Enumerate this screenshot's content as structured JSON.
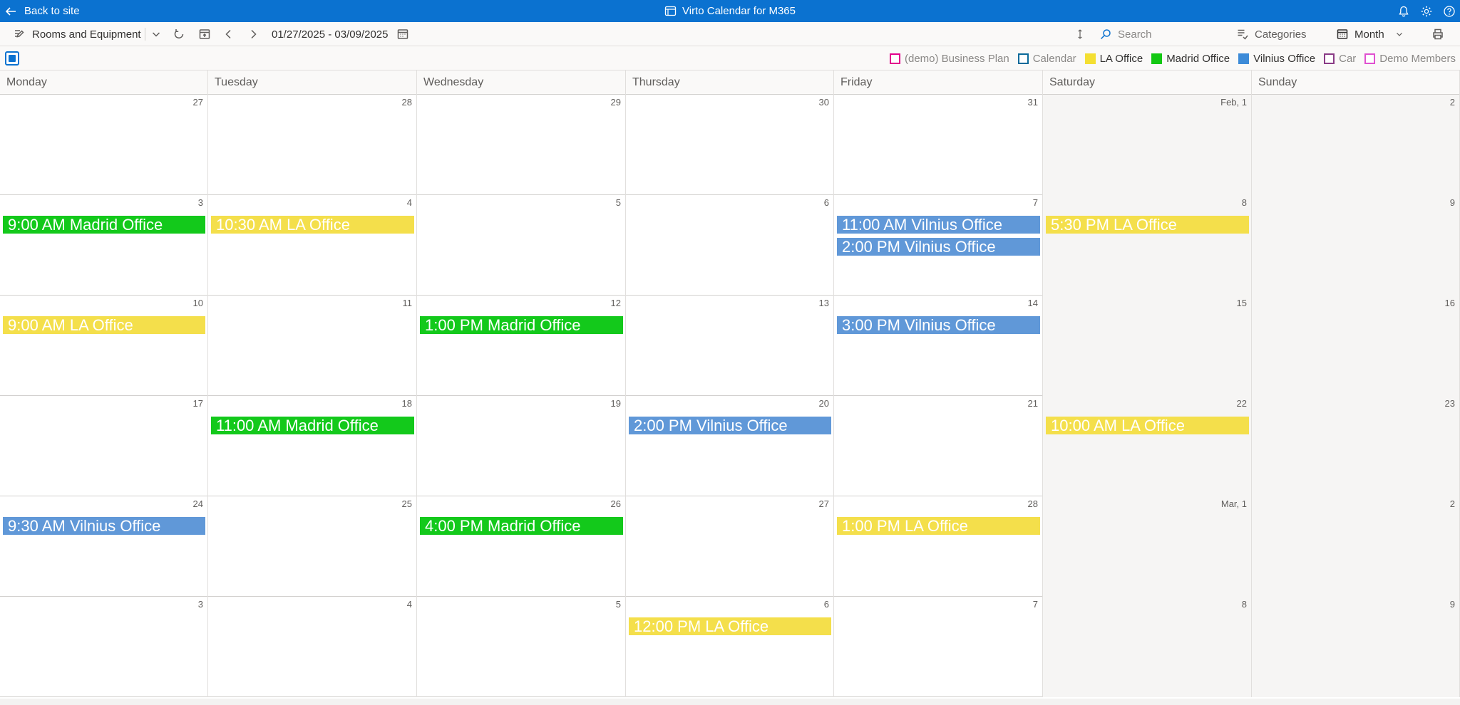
{
  "header": {
    "back_label": "Back to site",
    "app_title": "Virto Calendar for M365"
  },
  "toolbar": {
    "view_name": "Rooms and Equipment",
    "date_range": "01/27/2025 - 03/09/2025",
    "search_placeholder": "Search",
    "categories_label": "Categories",
    "view_mode_label": "Month"
  },
  "legend": [
    {
      "label": "(demo) Business Plan",
      "color": "#e3008c",
      "filled": false
    },
    {
      "label": "Calendar",
      "color": "#0b6a9a",
      "filled": false
    },
    {
      "label": "LA Office",
      "color": "#f4df32",
      "filled": true
    },
    {
      "label": "Madrid Office",
      "color": "#13c813",
      "filled": true
    },
    {
      "label": "Vilnius Office",
      "color": "#3d8bd8",
      "filled": true
    },
    {
      "label": "Car",
      "color": "#8a3b86",
      "filled": false
    },
    {
      "label": "Demo Members",
      "color": "#e050d0",
      "filled": false
    }
  ],
  "colors": {
    "la": "#f4df4b",
    "madrid": "#13c91b",
    "vilnius": "#6098d8",
    "brand": "#0b72d0"
  },
  "weekdays": [
    "Monday",
    "Tuesday",
    "Wednesday",
    "Thursday",
    "Friday",
    "Saturday",
    "Sunday"
  ],
  "weeks": [
    [
      "27",
      "28",
      "29",
      "30",
      "31",
      "Feb, 1",
      "2"
    ],
    [
      "3",
      "4",
      "5",
      "6",
      "7",
      "8",
      "9"
    ],
    [
      "10",
      "11",
      "12",
      "13",
      "14",
      "15",
      "16"
    ],
    [
      "17",
      "18",
      "19",
      "20",
      "21",
      "22",
      "23"
    ],
    [
      "24",
      "25",
      "26",
      "27",
      "28",
      "Mar, 1",
      "2"
    ],
    [
      "3",
      "4",
      "5",
      "6",
      "7",
      "8",
      "9"
    ]
  ],
  "events": [
    {
      "week": 1,
      "day": 0,
      "slot": 0,
      "text": "9:00 AM Madrid Office",
      "cal": "madrid"
    },
    {
      "week": 1,
      "day": 1,
      "slot": 0,
      "text": "10:30 AM LA Office",
      "cal": "la"
    },
    {
      "week": 1,
      "day": 4,
      "slot": 0,
      "text": "11:00 AM Vilnius Office",
      "cal": "vilnius"
    },
    {
      "week": 1,
      "day": 4,
      "slot": 1,
      "text": "2:00 PM Vilnius Office",
      "cal": "vilnius"
    },
    {
      "week": 1,
      "day": 5,
      "slot": 0,
      "text": "5:30 PM LA Office",
      "cal": "la"
    },
    {
      "week": 2,
      "day": 0,
      "slot": 0,
      "text": "9:00 AM LA Office",
      "cal": "la"
    },
    {
      "week": 2,
      "day": 2,
      "slot": 0,
      "text": "1:00 PM Madrid Office",
      "cal": "madrid"
    },
    {
      "week": 2,
      "day": 4,
      "slot": 0,
      "text": "3:00 PM Vilnius Office",
      "cal": "vilnius"
    },
    {
      "week": 3,
      "day": 1,
      "slot": 0,
      "text": "11:00 AM Madrid Office",
      "cal": "madrid"
    },
    {
      "week": 3,
      "day": 3,
      "slot": 0,
      "text": "2:00 PM Vilnius Office",
      "cal": "vilnius"
    },
    {
      "week": 3,
      "day": 5,
      "slot": 0,
      "text": "10:00 AM LA Office",
      "cal": "la"
    },
    {
      "week": 4,
      "day": 0,
      "slot": 0,
      "text": "9:30 AM Vilnius Office",
      "cal": "vilnius"
    },
    {
      "week": 4,
      "day": 2,
      "slot": 0,
      "text": "4:00 PM Madrid Office",
      "cal": "madrid"
    },
    {
      "week": 4,
      "day": 4,
      "slot": 0,
      "text": "1:00 PM LA Office",
      "cal": "la"
    },
    {
      "week": 5,
      "day": 3,
      "slot": 0,
      "text": "12:00 PM LA Office",
      "cal": "la"
    }
  ]
}
